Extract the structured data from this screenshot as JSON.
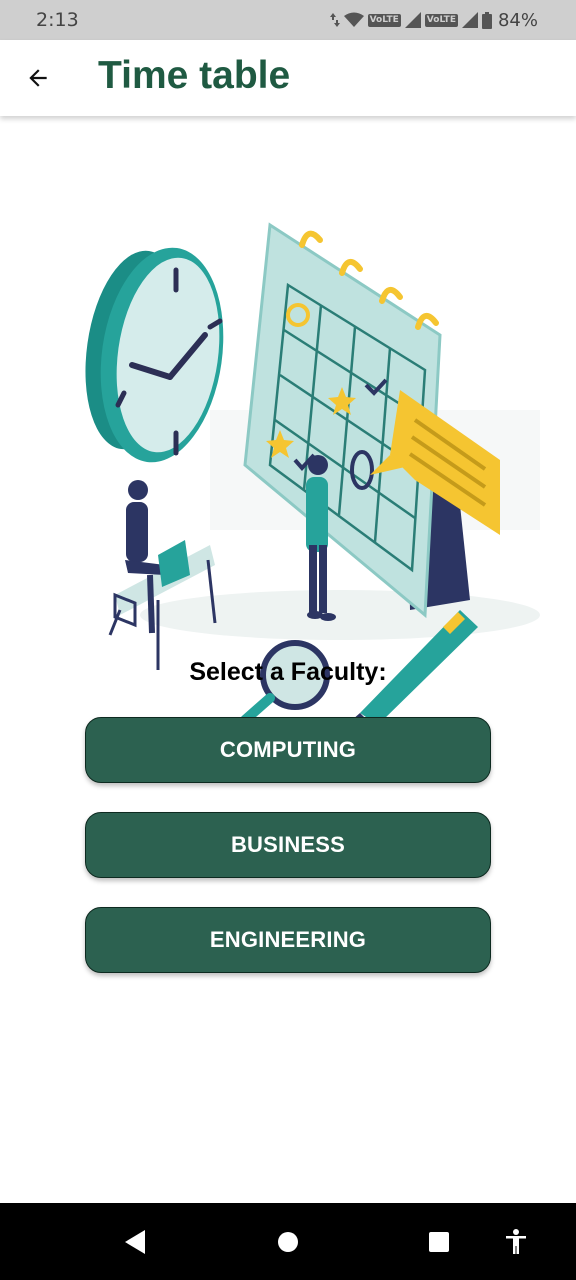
{
  "status_bar": {
    "time": "2:13",
    "volte_1": "VoLTE",
    "volte_2": "VoLTE",
    "battery_percent": "84%",
    "icons": [
      "data-arrows-icon",
      "wifi-icon",
      "signal-icon",
      "signal-icon",
      "battery-icon"
    ]
  },
  "app_bar": {
    "title": "Time table",
    "back_icon": "arrow-left-icon"
  },
  "content": {
    "illustration": "timetable-illustration",
    "select_label": "Select a Faculty:",
    "faculties": [
      "COMPUTING",
      "BUSINESS",
      "ENGINEERING"
    ]
  },
  "nav_bar": {
    "icons": [
      "back-triangle-icon",
      "home-circle-icon",
      "recents-square-icon",
      "accessibility-icon"
    ]
  },
  "colors": {
    "title": "#1f5a42",
    "button_bg": "#2c6150",
    "button_text": "#ffffff",
    "status_bar_bg": "#cfcfcf",
    "nav_bar_bg": "#000000"
  }
}
